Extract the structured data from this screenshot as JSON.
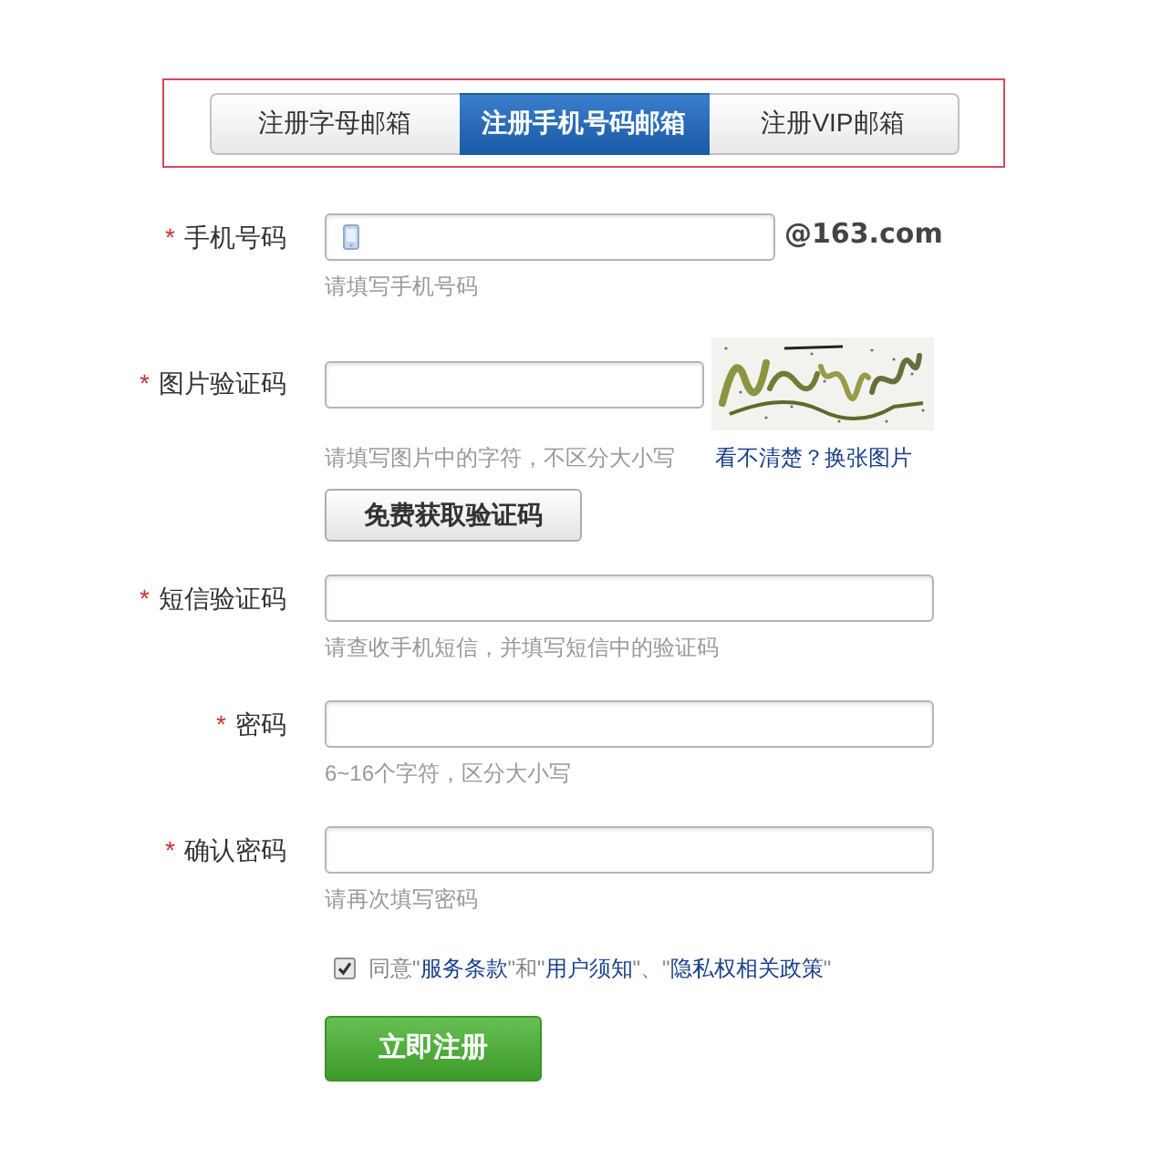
{
  "tabs": [
    {
      "label": "注册字母邮箱",
      "selected": false
    },
    {
      "label": "注册手机号码邮箱",
      "selected": true
    },
    {
      "label": "注册VIP邮箱",
      "selected": false
    }
  ],
  "fields": [
    {
      "kind": "phone",
      "required_mark": "*",
      "label": "手机号码",
      "suffix": "@163.com",
      "hint": "请填写手机号码"
    },
    {
      "kind": "captcha",
      "required_mark": "*",
      "label": "图片验证码",
      "hint": "请填写图片中的字符，不区分大小写",
      "refresh_link": "看不清楚？换张图片",
      "action_button": "免费获取验证码"
    },
    {
      "kind": "plain",
      "required_mark": "*",
      "label": "短信验证码",
      "hint": "请查收手机短信，并填写短信中的验证码"
    },
    {
      "kind": "plain",
      "required_mark": "*",
      "label": "密码",
      "hint": "6~16个字符，区分大小写"
    },
    {
      "kind": "plain",
      "required_mark": "*",
      "label": "确认密码",
      "hint": "请再次填写密码"
    }
  ],
  "agreement": {
    "checked": true,
    "parts": [
      {
        "kind": "text",
        "text": "同意\""
      },
      {
        "kind": "link",
        "text": "服务条款"
      },
      {
        "kind": "text",
        "text": "\"和\""
      },
      {
        "kind": "link",
        "text": "用户须知"
      },
      {
        "kind": "text",
        "text": "\"、\""
      },
      {
        "kind": "link",
        "text": "隐私权相关政策"
      },
      {
        "kind": "text",
        "text": "\""
      }
    ]
  },
  "submit_button": "立即注册"
}
